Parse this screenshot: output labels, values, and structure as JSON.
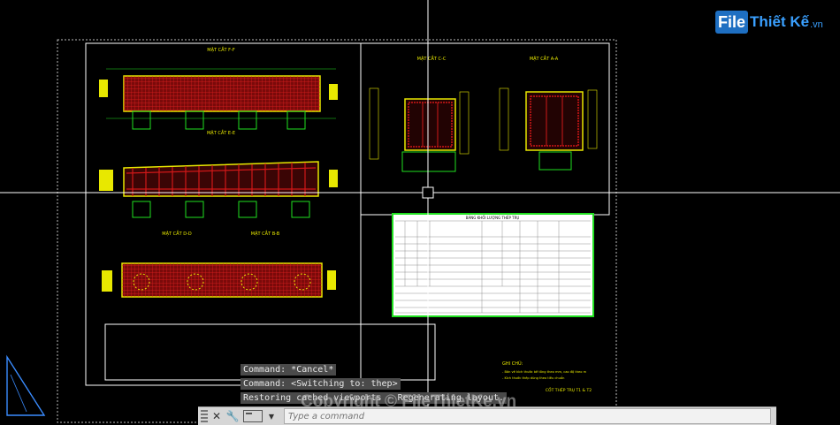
{
  "logo": {
    "badge": "File",
    "rest": "Thiết Kế",
    "domain": ".vn"
  },
  "drawing": {
    "section_titles": [
      "MẶT CẮT F-F",
      "MẶT CẮT E-E",
      "MẶT CẮT D-D",
      "MẶT CẮT C-C",
      "MẶT CẮT B-B",
      "MẶT CẮT A-A"
    ],
    "table_title": "BẢNG KHỐI LƯỢNG THÉP TRỤ",
    "notes_title": "GHI CHÚ:",
    "notes": [
      "- Bản vẽ kích thước bê tông theo mm, cao độ theo m",
      "- Kích thước thép dùng theo tiêu chuẩn"
    ],
    "stamp": "CỐT THÉP TRỤ T1 & T2"
  },
  "command_history": [
    "Command: *Cancel*",
    "Command:   <Switching to: thep>",
    "Restoring cached viewports - Regenerating layout."
  ],
  "command_line": {
    "placeholder": "Type a command"
  },
  "watermark": "Copyright © FileThietKe.vn",
  "colors": {
    "accent": "#1e6fc2",
    "rebar_red": "#d01818",
    "line_yellow": "#e8e800",
    "line_green": "#20e020"
  }
}
